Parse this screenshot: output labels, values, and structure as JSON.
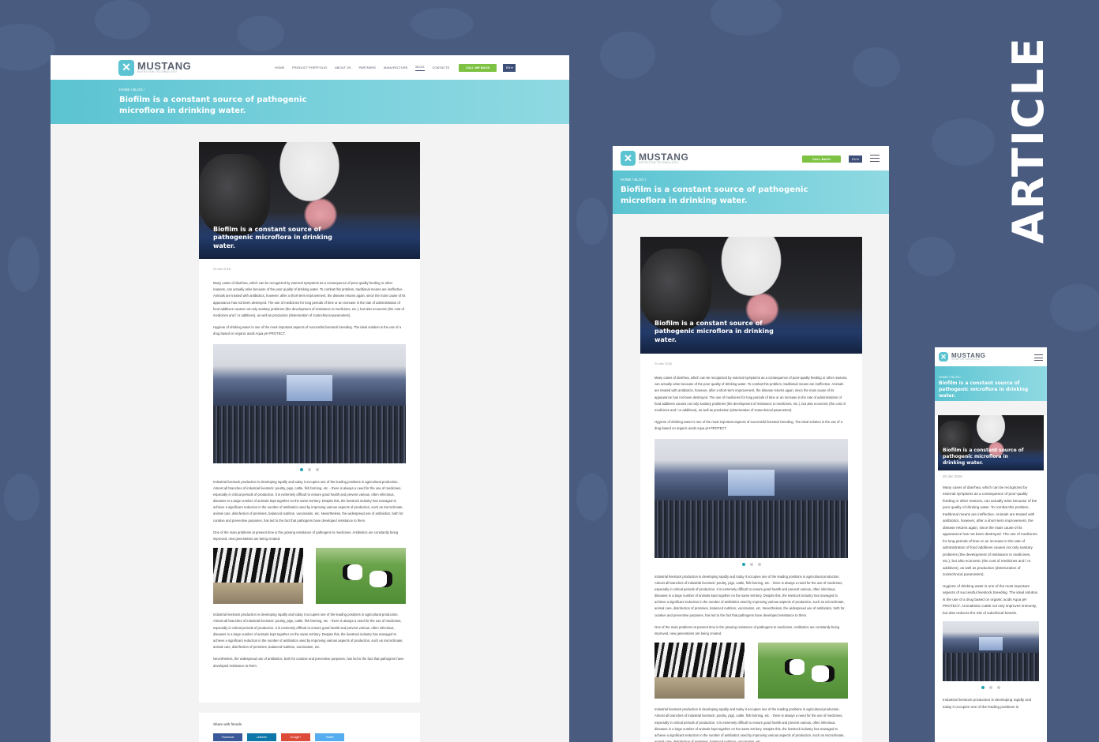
{
  "section_title": "ARTICLE",
  "brand": {
    "name": "MUSTANG",
    "tagline": "NUTRITION TECHNOLOGY"
  },
  "nav": {
    "items": [
      "HOME",
      "PRODUCT PORTFOLIO",
      "ABOUT US",
      "PARTNERS",
      "MANUFACTURE",
      "BLOG",
      "CONTACTS"
    ],
    "active": "BLOG",
    "cta": "CALL ME BACK",
    "cta_short": "CALL BACK",
    "lang": "EN ▾"
  },
  "hero": {
    "breadcrumb": "HOME / BLOG /",
    "title": "Biofilm is a constant source of pathogenic microflora in drinking water."
  },
  "article": {
    "cover_caption": "Biofilm is a constant source of pathogenic microflora in drinking water.",
    "date": "20 dec 2016",
    "p1": "Many cases of diarrhea, which can be recognized by external symptoms as a consequence of poor-quality feeding or other reasons, can actually arise because of the poor quality of drinking water. To combat this problem, traditional means are ineffective. Animals are treated with antibiotics, however, after a short-term improvement, the disease returns again, since the main cause of its appearance has not been destroyed. The use of medicines for long periods of time or an increase in the rate of administration of food additives causes not only sanitary problems (the development of resistance to medicines, etc.), but also economic (the cost of medicines and / or additives), as well as production (deterioration of zootechnical parameters).",
    "p2": "Hygiene of drinking water is one of the most important aspects of successful livestock breeding. The ideal solution is the use of a drug based on organic acids Aqua pH PROTECT.",
    "p2_mobile": "Hygiene of drinking water is one of the most important aspects of successful livestock breeding. The ideal solution is the use of a drug based on organic acids Aqua pH PROTECT. Aromabiotic Cattle not only improves immunity, but also reduces the risk of subclinical ketosis.",
    "p3": "Industrial livestock production is developing rapidly and today it occupies one of the leading positions in agricultural production. Almost all branches of industrial livestock: poultry, pigs, cattle, fish farming, etc. - there is always a need for the use of medicines, especially in critical periods of production. It is extremely difficult to ensure good health and prevent various, often infectious, diseases in a large number of animals kept together on the same territory. Despite this, the livestock industry has managed to achieve a significant reduction in the number of antibiotics used by improving various aspects of production, such as microclimate, animal care, disinfection of premises, balanced nutrition, vaccination, etc. Nevertheless, the widespread use of antibiotics, both for curative and preventive purposes, has led to the fact that pathogens have developed resistance to them.",
    "p4": "One of the main problems at present time is the growing resistance of pathogens to medicines. Antibiotics are constantly being improved, new generations are being created.",
    "p5": "Industrial livestock production is developing rapidly and today it occupies one of the leading positions in agricultural production. Almost all branches of industrial livestock: poultry, pigs, cattle, fish farming, etc. - there is always a need for the use of medicines, especially in critical periods of production. It is extremely difficult to ensure good health and prevent various, often infectious, diseases in a large number of animals kept together on the same territory. Despite this, the livestock industry has managed to achieve a significant reduction in the number of antibiotics used by improving various aspects of production, such as microclimate, animal care, disinfection of premises, balanced nutrition, vaccination, etc.",
    "p6": "Nevertheless, the widespread use of antibiotics, both for curative and preventive purposes, has led to the fact that pathogens have developed resistance to them.",
    "p_mobile_tail": "Industrial livestock production is developing rapidly and today it occupies one of the leading positions in"
  },
  "share": {
    "title": "Share with friends",
    "buttons": [
      "Facebook",
      "LinkedIn",
      "Google+",
      "Twitter"
    ]
  }
}
